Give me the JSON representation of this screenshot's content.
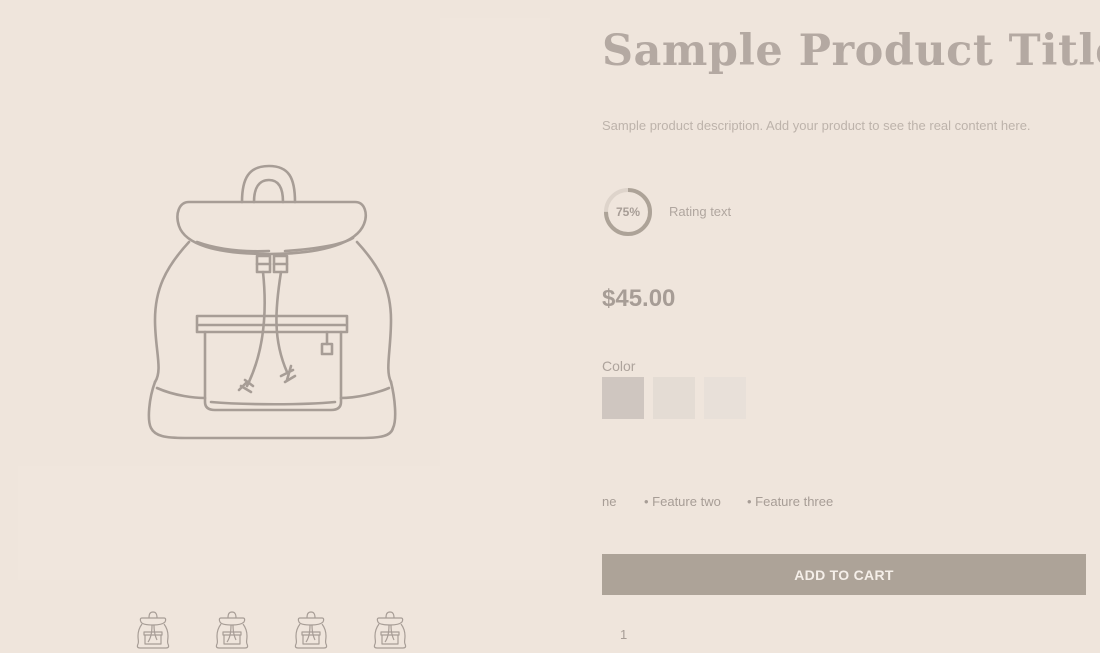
{
  "product": {
    "title": "Sample Product Title",
    "description": "Sample product description. Add your product to see the real content here.",
    "rating_percent": "75%",
    "rating_value": 0.75,
    "rating_text": "Rating text",
    "price": "$45.00",
    "color_label": "Color",
    "swatches": [
      {
        "color": "#cfc6c0"
      },
      {
        "color": "#e4dcd4"
      },
      {
        "color": "#e8e0d9"
      }
    ],
    "features": [
      "ne",
      "• Feature two",
      "• Feature three"
    ],
    "add_to_cart_label": "ADD TO CART",
    "quantity": "1"
  },
  "gallery": {
    "main_image_icon": "backpack-icon",
    "thumbnail_icon": "backpack-icon",
    "thumbnail_count": 4
  },
  "colors": {
    "background": "#efe5dc",
    "line": "#a79d96",
    "button": "#ada398",
    "button_text": "#f5efe9"
  }
}
